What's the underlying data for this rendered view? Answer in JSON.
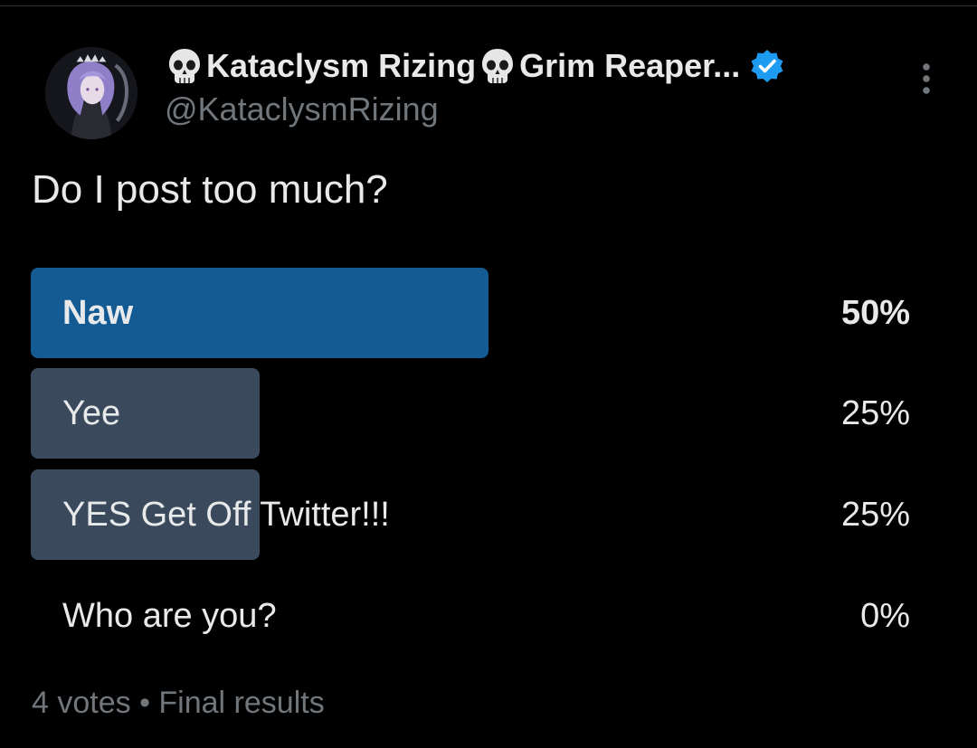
{
  "author": {
    "display_name": "Kataclysm Rizing",
    "display_name_suffix": "Grim Reaper...",
    "handle": "@KataclysmRizing",
    "name_emoji": "skull-icon",
    "verified_icon": "verified-badge-icon",
    "verified_color": "#1d9bf0",
    "avatar_icon": "profile-avatar"
  },
  "post": {
    "question": "Do I post too much?",
    "menu_icon": "more-vertical-icon"
  },
  "poll": {
    "options": [
      {
        "label": "Naw",
        "percent_text": "50%",
        "percent": 50,
        "winner": true
      },
      {
        "label": "Yee",
        "percent_text": "25%",
        "percent": 25,
        "winner": false
      },
      {
        "label": "YES Get Off Twitter!!!",
        "percent_text": "25%",
        "percent": 25,
        "winner": false
      },
      {
        "label": "Who are you?",
        "percent_text": "0%",
        "percent": 0,
        "winner": false
      }
    ],
    "footer": "4 votes • Final results",
    "colors": {
      "winner_bar": "#135b92",
      "other_bar": "#3a4a5c"
    }
  }
}
